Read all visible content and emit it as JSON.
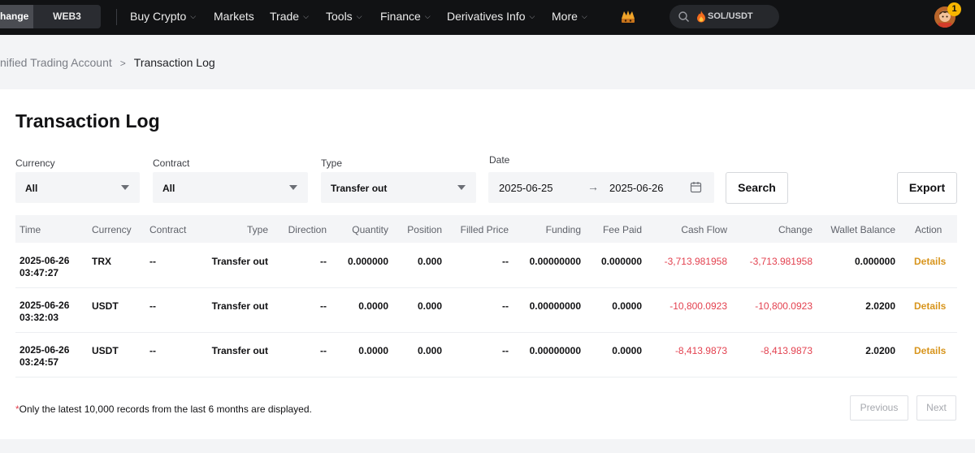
{
  "nav": {
    "segment_active": "hange",
    "segment_web3": "WEB3",
    "items": [
      {
        "label": "Buy Crypto",
        "chevron": true
      },
      {
        "label": "Markets",
        "chevron": false
      },
      {
        "label": "Trade",
        "chevron": true
      },
      {
        "label": "Tools",
        "chevron": true
      },
      {
        "label": "Finance",
        "chevron": true
      },
      {
        "label": "Derivatives Info",
        "chevron": true
      },
      {
        "label": "More",
        "chevron": true
      }
    ],
    "search_text": "SOL/USDT",
    "notification_count": "1"
  },
  "breadcrumb": {
    "previous": "nified Trading Account",
    "separator": ">",
    "current": "Transaction Log"
  },
  "page": {
    "title": "Transaction Log"
  },
  "filters": {
    "currency": {
      "label": "Currency",
      "value": "All"
    },
    "contract": {
      "label": "Contract",
      "value": "All"
    },
    "type": {
      "label": "Type",
      "value": "Transfer out"
    },
    "date": {
      "label": "Date",
      "start": "2025-06-25",
      "arrow": "→",
      "end": "2025-06-26"
    },
    "search_label": "Search",
    "export_label": "Export"
  },
  "table": {
    "columns": [
      "Time",
      "Currency",
      "Contract",
      "Type",
      "Direction",
      "Quantity",
      "Position",
      "Filled Price",
      "Funding",
      "Fee Paid",
      "Cash Flow",
      "Change",
      "Wallet Balance",
      "Action"
    ],
    "rows": [
      {
        "date": "2025-06-26",
        "time": "03:47:27",
        "currency": "TRX",
        "contract": "--",
        "type": "Transfer out",
        "direction": "--",
        "quantity": "0.000000",
        "position": "0.000",
        "filled_price": "--",
        "funding": "0.00000000",
        "fee_paid": "0.000000",
        "cash_flow": "-3,713.981958",
        "change": "-3,713.981958",
        "wallet_balance": "0.000000",
        "action": "Details"
      },
      {
        "date": "2025-06-26",
        "time": "03:32:03",
        "currency": "USDT",
        "contract": "--",
        "type": "Transfer out",
        "direction": "--",
        "quantity": "0.0000",
        "position": "0.000",
        "filled_price": "--",
        "funding": "0.00000000",
        "fee_paid": "0.0000",
        "cash_flow": "-10,800.0923",
        "change": "-10,800.0923",
        "wallet_balance": "2.0200",
        "action": "Details"
      },
      {
        "date": "2025-06-26",
        "time": "03:24:57",
        "currency": "USDT",
        "contract": "--",
        "type": "Transfer out",
        "direction": "--",
        "quantity": "0.0000",
        "position": "0.000",
        "filled_price": "--",
        "funding": "0.00000000",
        "fee_paid": "0.0000",
        "cash_flow": "-8,413.9873",
        "change": "-8,413.9873",
        "wallet_balance": "2.0200",
        "action": "Details"
      }
    ]
  },
  "footer": {
    "note_star": "*",
    "note": "Only the latest 10,000 records from the last 6 months are displayed.",
    "previous_label": "Previous",
    "next_label": "Next"
  },
  "colors": {
    "negative": "#e3414f",
    "link": "#d8951d",
    "nav_bg": "#111214"
  }
}
